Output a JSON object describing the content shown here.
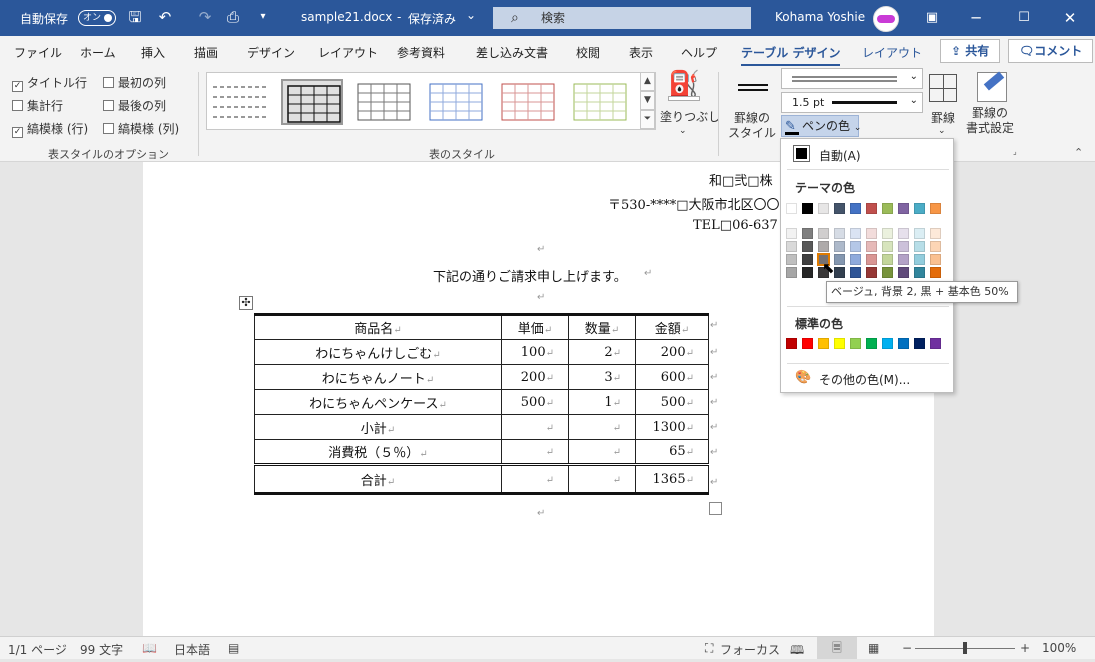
{
  "titlebar": {
    "autosave_label": "自動保存",
    "autosave_state": "オン",
    "filename": "sample21.docx",
    "sep": "-",
    "save_state": "保存済み",
    "save_chevron": "⌄",
    "search_placeholder": "検索",
    "user_name": "Kohama Yoshie"
  },
  "tabs": [
    "ファイル",
    "ホーム",
    "挿入",
    "描画",
    "デザイン",
    "レイアウト",
    "参考資料",
    "差し込み文書",
    "校閲",
    "表示",
    "ヘルプ",
    "テーブル デザイン",
    "レイアウト"
  ],
  "ribbon_buttons": {
    "share": "共有",
    "comment": "コメント"
  },
  "style_options": {
    "items": [
      {
        "label": "タイトル行",
        "checked": true
      },
      {
        "label": "集計行",
        "checked": false
      },
      {
        "label": "縞模様 (行)",
        "checked": true
      },
      {
        "label": "最初の列",
        "checked": false
      },
      {
        "label": "最後の列",
        "checked": false
      },
      {
        "label": "縞模様 (列)",
        "checked": false
      }
    ],
    "group_label": "表スタイルのオプション"
  },
  "table_styles": {
    "group_label": "表のスタイル",
    "shading_label": "塗りつぶし"
  },
  "borders": {
    "styles_label": "罫線の\nスタイル",
    "weight": "1.5 pt",
    "pen_color_label": "ペンの色",
    "borders_label": "罫線",
    "painter_label": "罫線の\n書式設定"
  },
  "pen_dropdown": {
    "auto_label": "自動(A)",
    "theme_label": "テーマの色",
    "standard_label": "標準の色",
    "more_label": "その他の色(M)...",
    "theme_top": [
      "#ffffff",
      "#000000",
      "#e7e6e6",
      "#44546a",
      "#4472c4",
      "#c0504d",
      "#9bbb59",
      "#8064a2",
      "#4bacc6",
      "#f79646"
    ],
    "theme_shades": [
      [
        "#f2f2f2",
        "#d9d9d9",
        "#bfbfbf",
        "#a6a6a6"
      ],
      [
        "#7f7f7f",
        "#595959",
        "#404040",
        "#262626"
      ],
      [
        "#d0cece",
        "#aeaaaa",
        "#767171",
        "#3a3838"
      ],
      [
        "#d6dce5",
        "#adb9ca",
        "#8497b0",
        "#323f4f"
      ],
      [
        "#dae3f3",
        "#b4c7e7",
        "#8faadc",
        "#2f5597"
      ],
      [
        "#f2dcdb",
        "#e6b9b8",
        "#d99694",
        "#953735"
      ],
      [
        "#ebf1de",
        "#d7e4bd",
        "#c3d69b",
        "#77933c"
      ],
      [
        "#e6e0ec",
        "#ccc1da",
        "#b3a2c7",
        "#604a7b"
      ],
      [
        "#dbeef4",
        "#b7dee8",
        "#93cddd",
        "#31859c"
      ],
      [
        "#fde9d9",
        "#fcd5b5",
        "#fac090",
        "#e46c0a"
      ]
    ],
    "standard": [
      "#c00000",
      "#ff0000",
      "#ffc000",
      "#ffff00",
      "#92d050",
      "#00b050",
      "#00b0f0",
      "#0070c0",
      "#002060",
      "#7030a0"
    ],
    "tooltip": "ベージュ, 背景 2, 黒 + 基本色 50%"
  },
  "document": {
    "company": "和□弐□株",
    "address": "〒530-****□大阪市北区〇〇",
    "tel": "TEL□06-637",
    "intro": "下記の通りご請求申し上げます。",
    "table": {
      "header": [
        "商品名",
        "単価",
        "数量",
        "金額"
      ],
      "rows": [
        [
          "わにちゃんけしごむ",
          "100",
          "2",
          "200"
        ],
        [
          "わにちゃんノート",
          "200",
          "3",
          "600"
        ],
        [
          "わにちゃんペンケース",
          "500",
          "1",
          "500"
        ],
        [
          "小計",
          "",
          "",
          "1300"
        ],
        [
          "消費税（５％）",
          "",
          "",
          "65"
        ]
      ],
      "total": [
        "合計",
        "",
        "",
        "1365"
      ]
    }
  },
  "status": {
    "page": "1/1 ページ",
    "words": "99 文字",
    "lang": "日本語",
    "focus": "フォーカス",
    "zoom": "100%"
  },
  "marks": {
    "return": "↵",
    "move": "✣"
  }
}
